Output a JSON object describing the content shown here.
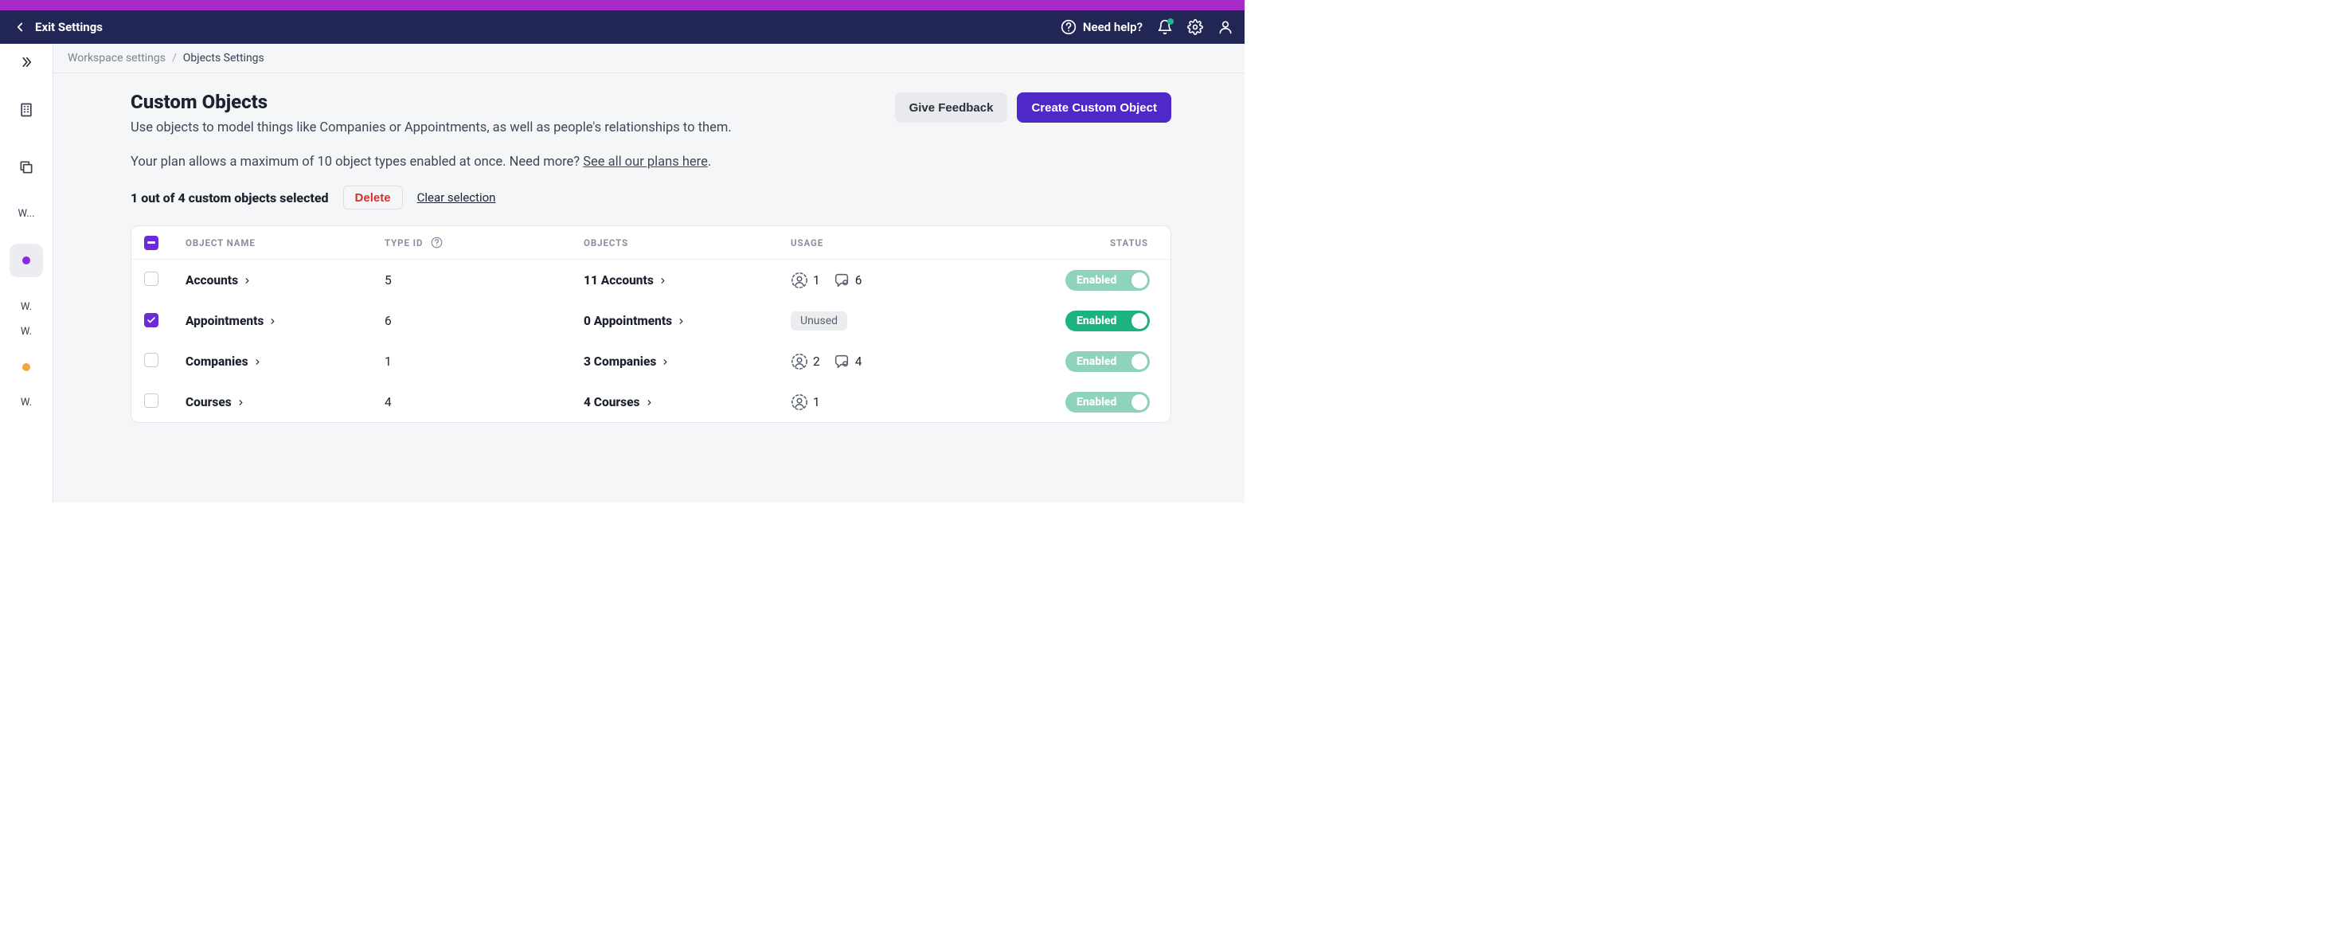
{
  "topbar": {
    "exit_label": "Exit Settings",
    "help_label": "Need help?"
  },
  "sidebar": {
    "label1": "W...",
    "label2": "W.",
    "label3": "W.",
    "label4": "W."
  },
  "breadcrumb": {
    "a": "Workspace settings",
    "b": "Objects Settings",
    "sep": "/"
  },
  "page": {
    "title": "Custom Objects",
    "subtitle": "Use objects to model things like Companies or Appointments, as well as people's relationships to them.",
    "plan_prefix": "Your plan allows a maximum of 10 object types enabled at once. Need more? ",
    "plan_link": "See all our plans here",
    "plan_suffix": ".",
    "feedback_btn": "Give Feedback",
    "create_btn": "Create Custom Object"
  },
  "selection": {
    "count_text": "1 out of 4 custom objects selected",
    "delete": "Delete",
    "clear": "Clear selection"
  },
  "table": {
    "headers": {
      "name": "OBJECT NAME",
      "type": "TYPE ID",
      "objects": "OBJECTS",
      "usage": "USAGE",
      "status": "STATUS"
    },
    "rows": [
      {
        "name": "Accounts",
        "type_id": "5",
        "objects_text": "11 Accounts",
        "usage_type": "counts",
        "ppl": "1",
        "tickets": "6",
        "status": "Enabled",
        "status_style": "dim",
        "selected": false
      },
      {
        "name": "Appointments",
        "type_id": "6",
        "objects_text": "0 Appointments",
        "usage_type": "unused",
        "unused_label": "Unused",
        "status": "Enabled",
        "status_style": "bright",
        "selected": true
      },
      {
        "name": "Companies",
        "type_id": "1",
        "objects_text": "3 Companies",
        "usage_type": "counts",
        "ppl": "2",
        "tickets": "4",
        "status": "Enabled",
        "status_style": "dim",
        "selected": false
      },
      {
        "name": "Courses",
        "type_id": "4",
        "objects_text": "4 Courses",
        "usage_type": "ppl-only",
        "ppl": "1",
        "status": "Enabled",
        "status_style": "dim",
        "selected": false
      }
    ]
  }
}
